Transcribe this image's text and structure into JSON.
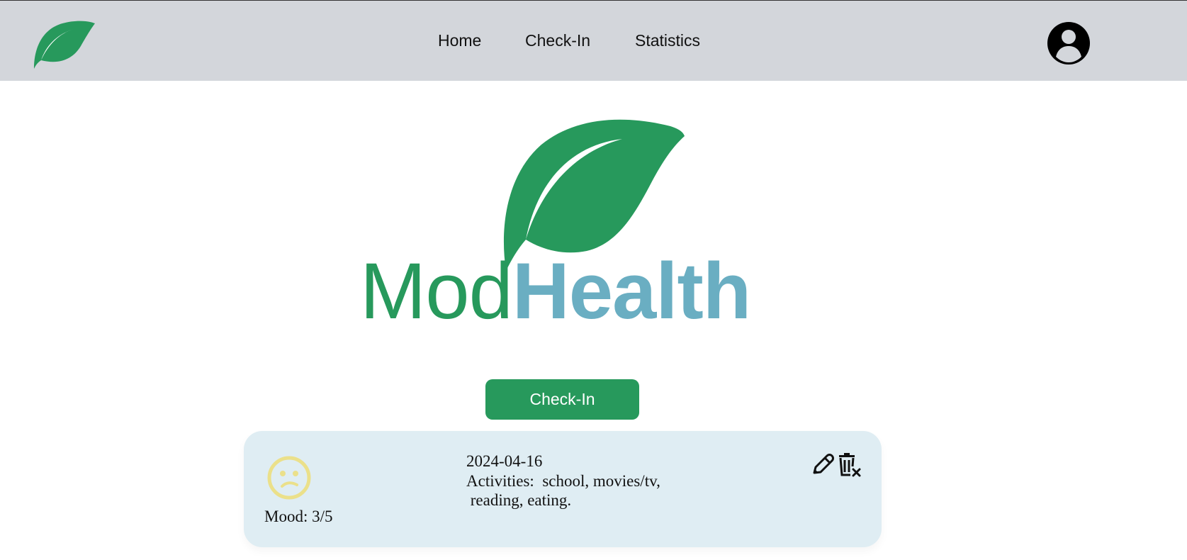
{
  "nav": {
    "logo_icon": "leaf-logo-icon",
    "links": [
      "Home",
      "Check-In",
      "Statistics"
    ],
    "avatar_icon": "user-avatar-icon"
  },
  "hero": {
    "word_mod": "Mod",
    "word_health": "Health",
    "leaf_icon": "leaf-icon"
  },
  "checkin_button": {
    "label": "Check-In"
  },
  "entry": {
    "mood_icon": "slightly-frowning-face-icon",
    "mood_label": "Mood: 3/5",
    "date": "2024-04-16",
    "activities_line1": "Activities:  school, movies/tv,",
    "activities_line2": " reading, eating.",
    "edit_icon": "pencil-icon",
    "delete_icon": "trash-icon"
  },
  "colors": {
    "brand_green": "#27995c",
    "brand_blue": "#6aaec2",
    "nav_bg": "#d3d6db",
    "card_bg": "#dfedf3",
    "mood_face": "#ebe08a"
  }
}
